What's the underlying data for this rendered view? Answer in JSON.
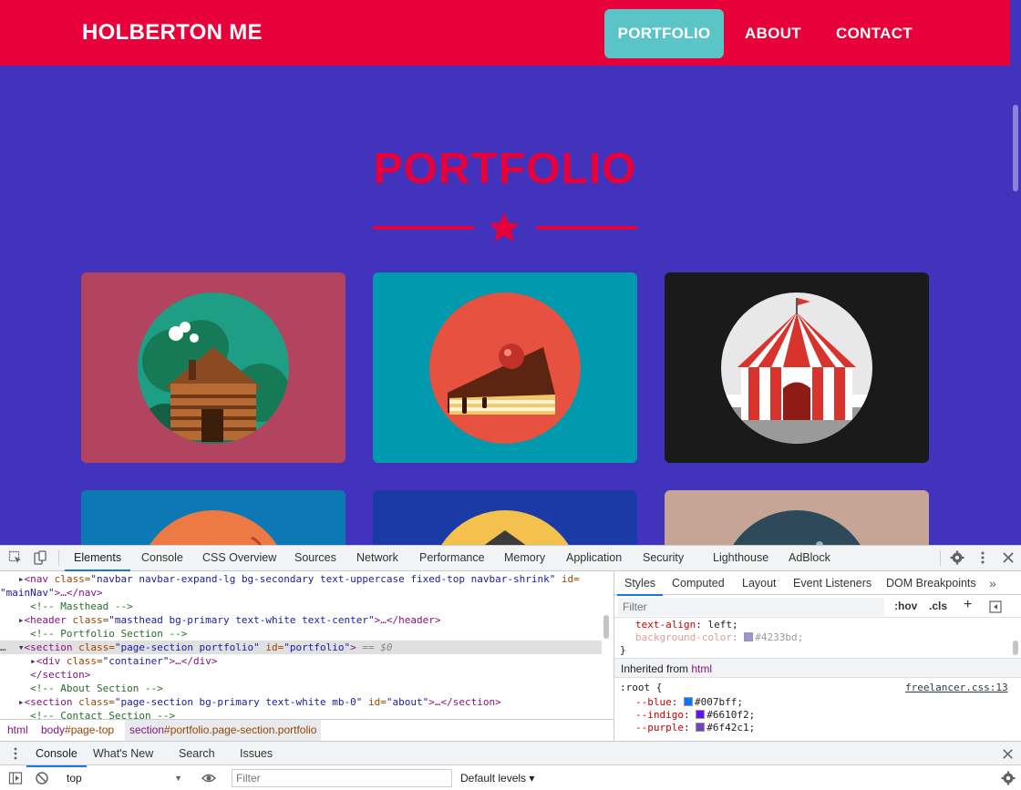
{
  "site": {
    "brand": "HOLBERTON ME",
    "nav": [
      {
        "label": "PORTFOLIO",
        "active": true
      },
      {
        "label": "ABOUT",
        "active": false
      },
      {
        "label": "CONTACT",
        "active": false
      }
    ],
    "section_title": "PORTFOLIO",
    "colors": {
      "primary_bg": "#4233bd",
      "secondary": "#e8003a",
      "nav_active": "#5bc4c6"
    },
    "portfolio_items": [
      {
        "icon": "cabin-icon",
        "bg": "#b3445f"
      },
      {
        "icon": "cake-icon",
        "bg": "#0099ad"
      },
      {
        "icon": "circus-tent-icon",
        "bg": "#1a1a1a"
      },
      {
        "icon": "game-controller-icon",
        "bg": "#0c79b4"
      },
      {
        "icon": "safe-icon",
        "bg": "#1a3aa6"
      },
      {
        "icon": "submarine-icon",
        "bg": "#c6a597"
      }
    ]
  },
  "devtools": {
    "tabs": [
      "Elements",
      "Console",
      "CSS Overview",
      "Sources",
      "Network",
      "Performance",
      "Memory",
      "Application",
      "Security",
      "Lighthouse",
      "AdBlock"
    ],
    "active_tab": "Elements",
    "dom_lines": {
      "l1_tag": "<nav",
      "l1_class": "class=",
      "l1_class_val": "\"navbar navbar-expand-lg bg-secondary text-uppercase fixed-top navbar-shrink\"",
      "l1_id": " id=",
      "l1_b": "\"mainNav\"",
      "l1_end": ">…</nav>",
      "l2": "<!-- Masthead -->",
      "l3_tag": "<header",
      "l3_class": " class=",
      "l3_class_val": "\"masthead bg-primary text-white text-center\"",
      "l3_end": ">…</header>",
      "l4": "<!-- Portfolio Section -->",
      "l5_tag": "<section",
      "l5_class": " class=",
      "l5_class_val": "\"page-section portfolio\"",
      "l5_id": " id=",
      "l5_id_val": "\"portfolio\"",
      "l5_end": ">",
      "l5_marker": " == $0",
      "l6_tag": "<div",
      "l6_class": " class=",
      "l6_class_val": "\"container\"",
      "l6_end": ">…</div>",
      "l7": "</section>",
      "l8": "<!-- About Section -->",
      "l9_tag": "<section",
      "l9_class": " class=",
      "l9_class_val": "\"page-section bg-primary text-white mb-0\"",
      "l9_id": " id=",
      "l9_id_val": "\"about\"",
      "l9_end": ">…</section>",
      "l10": "<!-- Contact Section -->"
    },
    "breadcrumbs": [
      {
        "a": "html",
        "b": ""
      },
      {
        "a": "body",
        "b": "#page-top"
      },
      {
        "a": "section",
        "b": "#portfolio.page-section.portfolio"
      }
    ],
    "styles_tabs": [
      "Styles",
      "Computed",
      "Layout",
      "Event Listeners",
      "DOM Breakpoints"
    ],
    "styles_filter_placeholder": "Filter",
    "hov": ":hov",
    "cls": ".cls",
    "rules": {
      "text_align_prop": "text-align",
      "text_align_val": "left;",
      "bg_prop": "background-color",
      "bg_val": "#4233bd;",
      "bg_swatch": "#9b95d8",
      "close_brace": "}",
      "inherited_label": "Inherited from ",
      "inherited_tag": "html",
      "root_selector": ":root {",
      "root_source": "freelancer.css:13",
      "vars": [
        {
          "name": "--blue",
          "value": "#007bff;",
          "color": "#007bff"
        },
        {
          "name": "--indigo",
          "value": "#6610f2;",
          "color": "#6610f2"
        },
        {
          "name": "--purple",
          "value": "#6f42c1;",
          "color": "#6f42c1"
        }
      ]
    },
    "drawer_tabs": [
      "Console",
      "What's New",
      "Search",
      "Issues"
    ],
    "console_context": "top",
    "console_filter_placeholder": "Filter",
    "default_levels": "Default levels ▾"
  }
}
